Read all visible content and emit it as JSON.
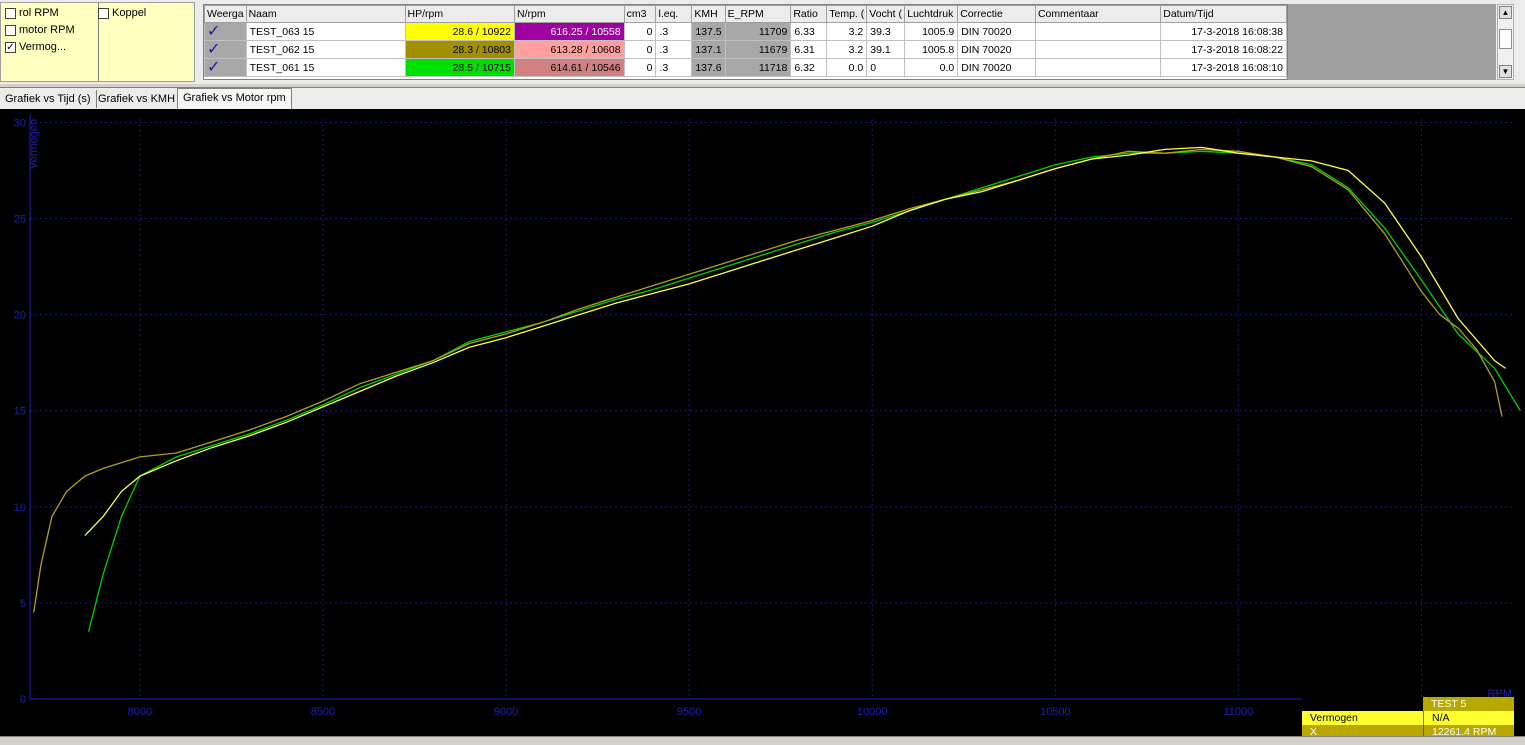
{
  "checkboxes": [
    {
      "label": "rol RPM",
      "checked": false
    },
    {
      "label": "motor RPM",
      "checked": false
    },
    {
      "label": "Vermog...",
      "checked": true
    },
    {
      "label": "Koppel",
      "checked": false
    }
  ],
  "table": {
    "headers": [
      "Weerga",
      "Naam",
      "HP/rpm",
      "N/rpm",
      "cm3",
      "l.eq.",
      "KMH",
      "E_RPM",
      "Ratio",
      "Temp. (",
      "Vocht (",
      "Luchtdruk",
      "Correctie",
      "Commentaar",
      "Datum/Tijd"
    ],
    "rows": [
      {
        "check": "✓",
        "naam": "TEST_063 15",
        "hp": "28.6 / 10922",
        "hp_color": "#ffff00",
        "n": "616.25 / 10558",
        "n_color": "#a000a0",
        "n_text_color": "#ffffff",
        "cm3": "0",
        "leq": ".3",
        "kmh": "137.5",
        "erpm": "11709",
        "ratio": "6.33",
        "temp": "3.2",
        "vocht": "39.3",
        "lucht": "1005.9",
        "corr": "DIN 70020",
        "comm": "",
        "datum": "17-3-2018 16:08:38"
      },
      {
        "check": "✓",
        "naam": "TEST_062 15",
        "hp": "28.3 / 10803",
        "hp_color": "#a09000",
        "n": "613.28 / 10608",
        "n_color": "#ffa0a0",
        "n_text_color": "#000000",
        "cm3": "0",
        "leq": ".3",
        "kmh": "137.1",
        "erpm": "11679",
        "ratio": "6.31",
        "temp": "3.2",
        "vocht": "39.1",
        "lucht": "1005.8",
        "corr": "DIN 70020",
        "comm": "",
        "datum": "17-3-2018 16:08:22"
      },
      {
        "check": "✓",
        "naam": "TEST_061 15",
        "hp": "28.5 / 10715",
        "hp_color": "#00e000",
        "n": "614.61 / 10546",
        "n_color": "#d08080",
        "n_text_color": "#000000",
        "cm3": "0",
        "leq": ".3",
        "kmh": "137.6",
        "erpm": "11718",
        "ratio": "6.32",
        "temp": "0.0",
        "vocht": "0",
        "lucht": "0.0",
        "corr": "DIN 70020",
        "comm": "",
        "datum": "17-3-2018 16:08:10"
      }
    ]
  },
  "scroll": {
    "up": "▲",
    "down": "▼"
  },
  "tabs": [
    {
      "label": "Grafiek vs Tijd (s)",
      "active": false
    },
    {
      "label": "Grafiek vs KMH",
      "active": false
    },
    {
      "label": "Grafiek vs Motor rpm",
      "active": true
    }
  ],
  "chart_data": {
    "type": "line",
    "ylabel": "Vermogen",
    "xlabel": "RPM",
    "xlim": [
      7700,
      11750
    ],
    "ylim": [
      0,
      30.7
    ],
    "x_ticks": [
      8000,
      8500,
      9000,
      9500,
      10000,
      10500,
      11000,
      11500
    ],
    "y_ticks": [
      0,
      5,
      10,
      15,
      20,
      25,
      30
    ],
    "grid": true,
    "series": [
      {
        "name": "TEST_061 15",
        "color": "#00d000",
        "x": [
          7860,
          7900,
          7950,
          8000,
          8100,
          8200,
          8300,
          8400,
          8500,
          8600,
          8700,
          8800,
          8900,
          9000,
          9100,
          9200,
          9300,
          9400,
          9500,
          9600,
          9700,
          9800,
          9900,
          10000,
          10100,
          10200,
          10300,
          10400,
          10500,
          10600,
          10700,
          10800,
          10900,
          11000,
          11100,
          11200,
          11300,
          11400,
          11500,
          11600,
          11700,
          11770
        ],
        "y": [
          3.5,
          6.5,
          9.5,
          11.6,
          12.6,
          13.2,
          13.8,
          14.5,
          15.3,
          16.2,
          16.9,
          17.6,
          18.6,
          19.1,
          19.6,
          20.2,
          20.8,
          21.3,
          21.9,
          22.5,
          23.1,
          23.7,
          24.3,
          24.8,
          25.4,
          26.0,
          26.6,
          27.2,
          27.8,
          28.2,
          28.4,
          28.4,
          28.5,
          28.4,
          28.2,
          27.8,
          26.6,
          24.5,
          21.8,
          19.0,
          17.2,
          15.0
        ]
      },
      {
        "name": "TEST_062 15",
        "color": "#b0a020",
        "x": [
          7710,
          7730,
          7760,
          7800,
          7850,
          7900,
          7950,
          8000,
          8100,
          8200,
          8300,
          8400,
          8500,
          8600,
          8700,
          8800,
          8900,
          9000,
          9100,
          9200,
          9300,
          9400,
          9500,
          9600,
          9700,
          9800,
          9900,
          10000,
          10100,
          10200,
          10300,
          10400,
          10500,
          10600,
          10700,
          10800,
          10900,
          11000,
          11100,
          11200,
          11300,
          11400,
          11500,
          11550,
          11600,
          11650,
          11700,
          11720
        ],
        "y": [
          4.5,
          7.0,
          9.5,
          10.8,
          11.6,
          12.0,
          12.3,
          12.6,
          12.8,
          13.4,
          14.0,
          14.7,
          15.5,
          16.4,
          17.0,
          17.6,
          18.5,
          19.0,
          19.6,
          20.3,
          20.9,
          21.5,
          22.1,
          22.7,
          23.3,
          23.9,
          24.4,
          24.9,
          25.5,
          26.0,
          26.5,
          27.0,
          27.6,
          28.1,
          28.5,
          28.4,
          28.6,
          28.5,
          28.2,
          27.7,
          26.5,
          24.2,
          21.2,
          20.0,
          19.3,
          18.2,
          16.5,
          14.7
        ]
      },
      {
        "name": "TEST_063 15",
        "color": "#ffff40",
        "x": [
          7850,
          7900,
          7950,
          8000,
          8100,
          8200,
          8300,
          8400,
          8500,
          8600,
          8700,
          8800,
          8900,
          9000,
          9100,
          9200,
          9300,
          9400,
          9500,
          9600,
          9700,
          9800,
          9900,
          10000,
          10100,
          10200,
          10300,
          10400,
          10500,
          10600,
          10700,
          10800,
          10900,
          11000,
          11100,
          11200,
          11300,
          11400,
          11500,
          11600,
          11700,
          11730
        ],
        "y": [
          8.5,
          9.5,
          10.8,
          11.6,
          12.4,
          13.1,
          13.7,
          14.4,
          15.2,
          16.0,
          16.8,
          17.5,
          18.3,
          18.8,
          19.4,
          20.0,
          20.6,
          21.1,
          21.6,
          22.2,
          22.8,
          23.4,
          24.0,
          24.6,
          25.4,
          26.0,
          26.4,
          27.0,
          27.6,
          28.1,
          28.3,
          28.6,
          28.7,
          28.4,
          28.2,
          28.0,
          27.5,
          25.8,
          23.0,
          19.8,
          17.6,
          17.2
        ]
      }
    ]
  },
  "infobox": {
    "test_label": "TEST 5",
    "row1_label": "Vermogen",
    "row1_value": "N/A",
    "row2_label": "X",
    "row2_value": "12261.4 RPM"
  }
}
